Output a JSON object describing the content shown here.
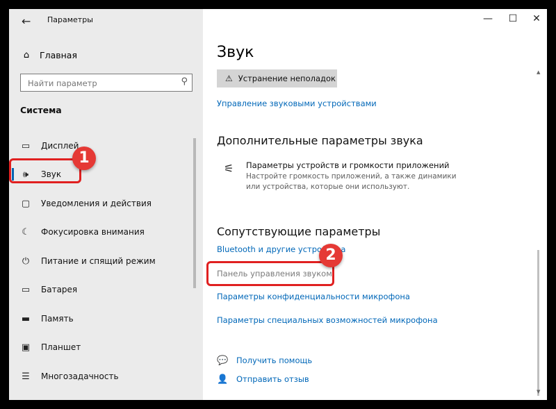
{
  "window": {
    "app_title": "Параметры",
    "back_icon": "arrow-left-icon",
    "controls": {
      "minimize": "—",
      "maximize": "☐",
      "close": "✕"
    }
  },
  "sidebar": {
    "home_label": "Главная",
    "search_placeholder": "Найти параметр",
    "section_title": "Система",
    "items": [
      {
        "label": "Дисплей",
        "icon": "display-icon"
      },
      {
        "label": "Звук",
        "icon": "speaker-icon",
        "active": true
      },
      {
        "label": "Уведомления и действия",
        "icon": "notification-icon"
      },
      {
        "label": "Фокусировка внимания",
        "icon": "moon-icon"
      },
      {
        "label": "Питание и спящий режим",
        "icon": "power-icon"
      },
      {
        "label": "Батарея",
        "icon": "battery-icon"
      },
      {
        "label": "Память",
        "icon": "storage-icon"
      },
      {
        "label": "Планшет",
        "icon": "tablet-icon"
      },
      {
        "label": "Многозадачность",
        "icon": "multitasking-icon"
      }
    ]
  },
  "main": {
    "title": "Звук",
    "troubleshoot_label": "Устранение неполадок",
    "manage_devices_link": "Управление звуковыми устройствами",
    "advanced_heading": "Дополнительные параметры звука",
    "advanced_item_title": "Параметры устройств и громкости приложений",
    "advanced_item_desc": "Настройте громкость приложений, а также динамики или устройства, которые они используют.",
    "related_heading": "Сопутствующие параметры",
    "related_links": {
      "bluetooth": "Bluetooth и другие устройства",
      "sound_panel": "Панель управления звуком",
      "mic_privacy": "Параметры конфиденциальности микрофона",
      "mic_accessibility": "Параметры специальных возможностей микрофона"
    },
    "help_label": "Получить помощь",
    "feedback_label": "Отправить отзыв"
  },
  "annotations": {
    "badge1": "1",
    "badge2": "2",
    "highlight_color": "#e02020"
  },
  "colors": {
    "accent": "#0067b8",
    "sidebar_bg": "#ebebeb",
    "badge": "#e53935"
  }
}
